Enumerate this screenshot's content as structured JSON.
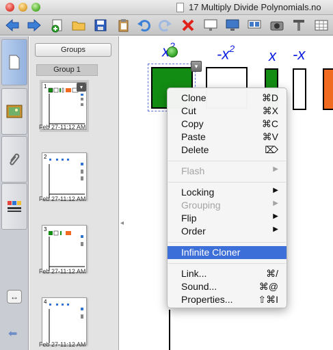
{
  "window": {
    "title": "17 Multiply Divide Polynomials.no"
  },
  "toolbar": {
    "icons": [
      "back-arrow-icon",
      "forward-arrow-icon",
      "add-page-icon",
      "open-folder-icon",
      "save-disk-icon",
      "paste-clipboard-icon",
      "undo-icon",
      "redo-icon",
      "delete-x-icon",
      "screen-shade-icon",
      "display-icon",
      "dual-display-icon",
      "camera-icon",
      "table-icon",
      "grid-icon"
    ]
  },
  "sorter": {
    "groups_label": "Groups",
    "group_label": "Group 1",
    "pages": [
      {
        "num": "1",
        "date": "Feb 27-11:12 AM"
      },
      {
        "num": "2",
        "date": "Feb 27-11:12 AM"
      },
      {
        "num": "3",
        "date": "Feb 27-11:12 AM"
      },
      {
        "num": "4",
        "date": "Feb 27-11:12 AM"
      }
    ]
  },
  "canvas": {
    "labels": {
      "x2": "x",
      "x2_exp": "2",
      "neg_x2": "-x",
      "neg_x2_exp": "2",
      "x": "x",
      "neg_x": "-x"
    },
    "colors": {
      "green": "#138c13",
      "orange": "#f06a20",
      "label_blue": "#0b1ee0"
    }
  },
  "context_menu": {
    "items": [
      {
        "label": "Clone",
        "shortcut": "⌘D"
      },
      {
        "label": "Cut",
        "shortcut": "⌘X"
      },
      {
        "label": "Copy",
        "shortcut": "⌘C"
      },
      {
        "label": "Paste",
        "shortcut": "⌘V"
      },
      {
        "label": "Delete",
        "shortcut": "⌦"
      },
      {
        "label": "Flash"
      },
      {
        "label": "Locking"
      },
      {
        "label": "Grouping"
      },
      {
        "label": "Flip"
      },
      {
        "label": "Order"
      },
      {
        "label": "Infinite Cloner"
      },
      {
        "label": "Link...",
        "shortcut": "⌘/"
      },
      {
        "label": "Sound...",
        "shortcut": "⌘@"
      },
      {
        "label": "Properties...",
        "shortcut": "⇧⌘I"
      }
    ]
  }
}
